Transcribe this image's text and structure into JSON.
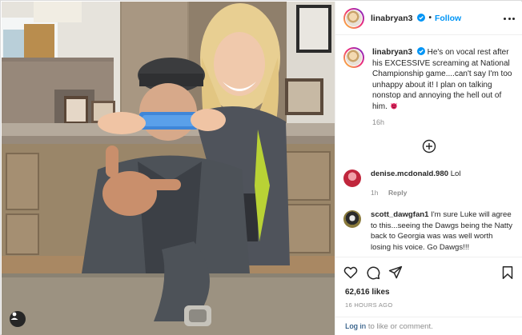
{
  "post": {
    "username": "linabryan3",
    "follow_label": "Follow",
    "separator": "•",
    "caption": {
      "username": "linabryan3",
      "text": "He's on vocal rest after his EXCESSIVE screaming at National Championship game....can't say I'm too unhappy about it! I plan on talking nonstop and annoying the hell out of him.",
      "emoji_icon": "smiling-devil-icon",
      "time": "16h"
    },
    "comments": [
      {
        "username": "denise.mcdonald.980",
        "text": "Lol",
        "time": "1h",
        "reply_label": "Reply"
      },
      {
        "username": "scott_dawgfan1",
        "text": "I'm sure Luke will agree to this...seeing the Dawgs being the Natty back to Georgia was was well worth losing his voice. Go Dawgs!!!"
      }
    ],
    "likes": "62,616 likes",
    "date": "16 HOURS AGO",
    "login": {
      "link": "Log in",
      "text": "to like or comment."
    }
  },
  "icons": [
    "verified-badge-icon",
    "more-options-icon",
    "load-more-comments-icon",
    "heart-icon",
    "comment-icon",
    "share-icon",
    "bookmark-icon",
    "tagged-user-icon"
  ],
  "colors": {
    "accent": "#0095f6",
    "text": "#262626",
    "muted": "#8e8e8e",
    "link": "#00376b",
    "devil": "#e0245e"
  }
}
